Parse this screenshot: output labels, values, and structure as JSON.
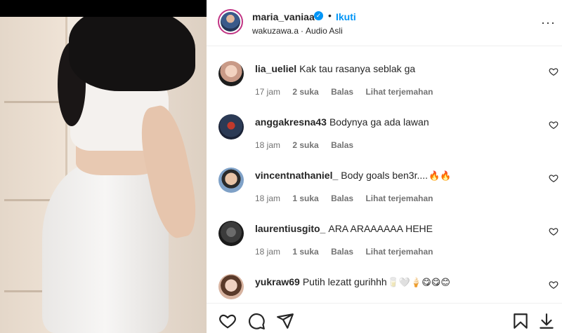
{
  "post": {
    "username": "maria_vaniaa",
    "verified_icon": "verified-badge-icon",
    "separator": "•",
    "follow_label": "Ikuti",
    "audio_owner": "wakuzawa.a",
    "audio_sep": "·",
    "audio_label": "Audio Asli",
    "more_icon": "more-options-icon",
    "more_glyph": "···"
  },
  "comments": [
    {
      "username": "lia_ueliel",
      "text": "Kak tau rasanya seblak ga",
      "time": "17 jam",
      "likes": "2 suka",
      "reply": "Balas",
      "translate": "Lihat terjemahan",
      "avatar_color": "#c99a87"
    },
    {
      "username": "anggakresna43",
      "text": "Bodynya ga ada lawan",
      "time": "18 jam",
      "likes": "2 suka",
      "reply": "Balas",
      "translate": "",
      "avatar_color": "#2b3a55"
    },
    {
      "username": "vincentnathaniel_",
      "text": "Body goals ben3r....",
      "emoji": "🔥🔥",
      "time": "18 jam",
      "likes": "1 suka",
      "reply": "Balas",
      "translate": "Lihat terjemahan",
      "avatar_color": "#b98a6b"
    },
    {
      "username": "laurentiusgito_",
      "text": "ARA ARAAAAAA HEHE",
      "time": "18 jam",
      "likes": "1 suka",
      "reply": "Balas",
      "translate": "Lihat terjemahan",
      "avatar_color": "#3c3c3c"
    },
    {
      "username": "yukraw69",
      "text": "Putih lezatt gurihhh",
      "emoji": "🥛🤍🍦😋😋😊",
      "time": "",
      "likes": "",
      "reply": "",
      "translate": "",
      "avatar_color": "#d7b3a0"
    }
  ],
  "actions": {
    "like_icon": "heart-icon",
    "comment_icon": "comment-icon",
    "share_icon": "share-icon",
    "save_icon": "bookmark-icon",
    "download_icon": "download-icon"
  },
  "colors": {
    "accent": "#0095f6",
    "text": "#262626",
    "muted": "#737373"
  }
}
